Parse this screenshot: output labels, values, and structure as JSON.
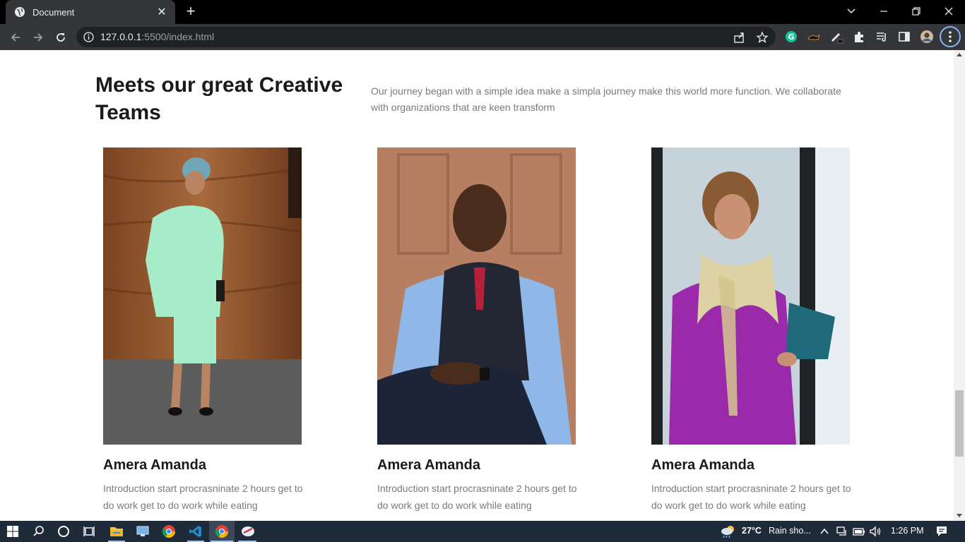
{
  "browser": {
    "tab_title": "Document",
    "tab_close": "✕",
    "new_tab": "+",
    "url_host": "127.0.0.1",
    "url_rest": ":5500/index.html"
  },
  "section": {
    "heading": "Meets our great Creative Teams",
    "intro": "Our journey began with a simple idea make a simpla journey make this world more function. We collaborate with organizations that are keen transform"
  },
  "team": [
    {
      "name": "Amera Amanda",
      "description": "Introduction start procrasninate 2 hours get to do work get to do work while eating"
    },
    {
      "name": "Amera Amanda",
      "description": "Introduction start procrasninate 2 hours get to do work get to do work while eating"
    },
    {
      "name": "Amera Amanda",
      "description": "Introduction start procrasninate 2 hours get to do work get to do work while eating"
    }
  ],
  "taskbar": {
    "weather_temp": "27°C",
    "weather_text": "Rain sho...",
    "time": "1:26 PM"
  },
  "colors": {
    "chrome_dark": "#35363a",
    "taskbar": "#202b3a",
    "heading_text": "#1a1a1a",
    "body_text": "#7a7a7a"
  }
}
